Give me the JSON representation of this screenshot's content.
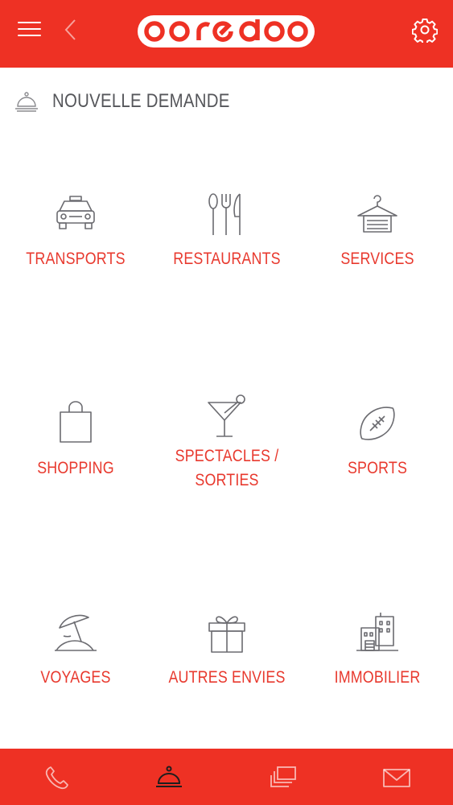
{
  "app": {
    "brand": "ooredoo",
    "brand_color": "#ee3124",
    "label_color": "#e8392e",
    "title_color": "#55565a",
    "icon_color": "#6b6b70"
  },
  "header": {
    "menu_icon": "hamburger-menu-icon",
    "back_icon": "chevron-left-icon",
    "settings_icon": "gear-icon"
  },
  "page": {
    "title": "NOUVELLE DEMANDE",
    "title_icon": "service-bell-icon"
  },
  "categories": [
    {
      "label": "TRANSPORTS",
      "icon": "taxi-icon"
    },
    {
      "label": "RESTAURANTS",
      "icon": "cutlery-icon"
    },
    {
      "label": "SERVICES",
      "icon": "hanger-icon"
    },
    {
      "label": "SHOPPING",
      "icon": "shopping-bag-icon"
    },
    {
      "label": "SPECTACLES /",
      "label2": "SORTIES",
      "icon": "cocktail-icon"
    },
    {
      "label": "SPORTS",
      "icon": "football-icon"
    },
    {
      "label": "VOYAGES",
      "icon": "beach-umbrella-icon"
    },
    {
      "label": "AUTRES ENVIES",
      "icon": "gift-icon"
    },
    {
      "label": "IMMOBILIER",
      "icon": "buildings-icon"
    }
  ],
  "bottom_nav": [
    {
      "icon": "phone-icon",
      "active": false
    },
    {
      "icon": "service-bell-icon",
      "active": true
    },
    {
      "icon": "stacked-cards-icon",
      "active": false
    },
    {
      "icon": "envelope-icon",
      "active": false
    }
  ]
}
